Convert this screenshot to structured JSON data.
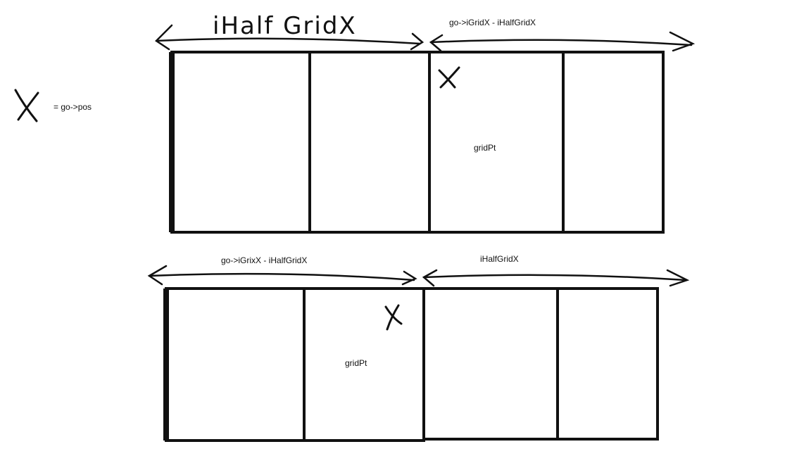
{
  "legend": {
    "marker": "X",
    "text": "= go->pos"
  },
  "top_diagram": {
    "left_span_label": "iHalf GridX",
    "right_span_label": "go->iGridX - iHalfGridX",
    "pos_marker": "X",
    "grid_point_label": "gridPt"
  },
  "bottom_diagram": {
    "left_span_label": "go->iGrixX - iHalfGridX",
    "right_span_label": "iHalfGridX",
    "pos_marker": "X",
    "grid_point_label": "gridPt"
  }
}
